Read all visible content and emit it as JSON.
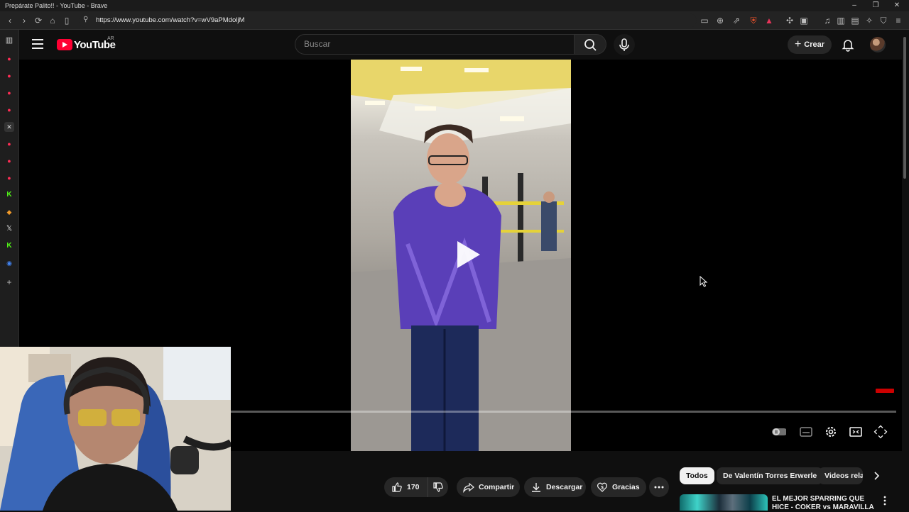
{
  "window": {
    "title": "Prepárate Palito!! - YouTube - Brave",
    "controls": [
      "minimize",
      "restore",
      "close"
    ]
  },
  "browser": {
    "url": "https://www.youtube.com/watch?v=wV9aPMdoljM",
    "nav_icons": [
      "back-icon",
      "forward-icon",
      "reload-icon",
      "home-icon",
      "bookmark-icon"
    ],
    "right_icons": [
      "cast-icon",
      "zoom-icon",
      "share-icon",
      "brave-shields-icon",
      "brave-rewards-icon",
      "extensions-icon",
      "screenshot-icon",
      "media-icon",
      "sidebar-icon",
      "wallet-icon",
      "leo-icon",
      "vpn-icon",
      "menu-icon"
    ],
    "side_panel": [
      "sidebar-toggle-icon",
      "youtube-tab-icon",
      "youtube-tab-icon",
      "youtube-tab-icon",
      "youtube-tab-icon",
      "close-tab-icon",
      "youtube-tab-icon",
      "youtube-tab-icon",
      "youtube-tab-icon",
      "kick-icon",
      "extension-icon",
      "x-icon",
      "kick-icon",
      "chrome-icon",
      "add-icon"
    ]
  },
  "youtube": {
    "logo_text": "YouTube",
    "country_code": "AR",
    "search_placeholder": "Buscar",
    "create_label": "Crear"
  },
  "player": {
    "state": "paused",
    "progress": 0.0
  },
  "actions": {
    "likes": "170",
    "share_label": "Compartir",
    "download_label": "Descargar",
    "thanks_label": "Gracias"
  },
  "chips": [
    "Todos",
    "De Valentín Torres Erwerle",
    "Videos rela"
  ],
  "recommendation": {
    "title": "EL MEJOR SPARRING QUE HICE - COKER vs MARAVILLA"
  },
  "colors": {
    "youtube_red": "#ff0033",
    "background": "#0f0f0f",
    "pill_bg": "#272727"
  }
}
